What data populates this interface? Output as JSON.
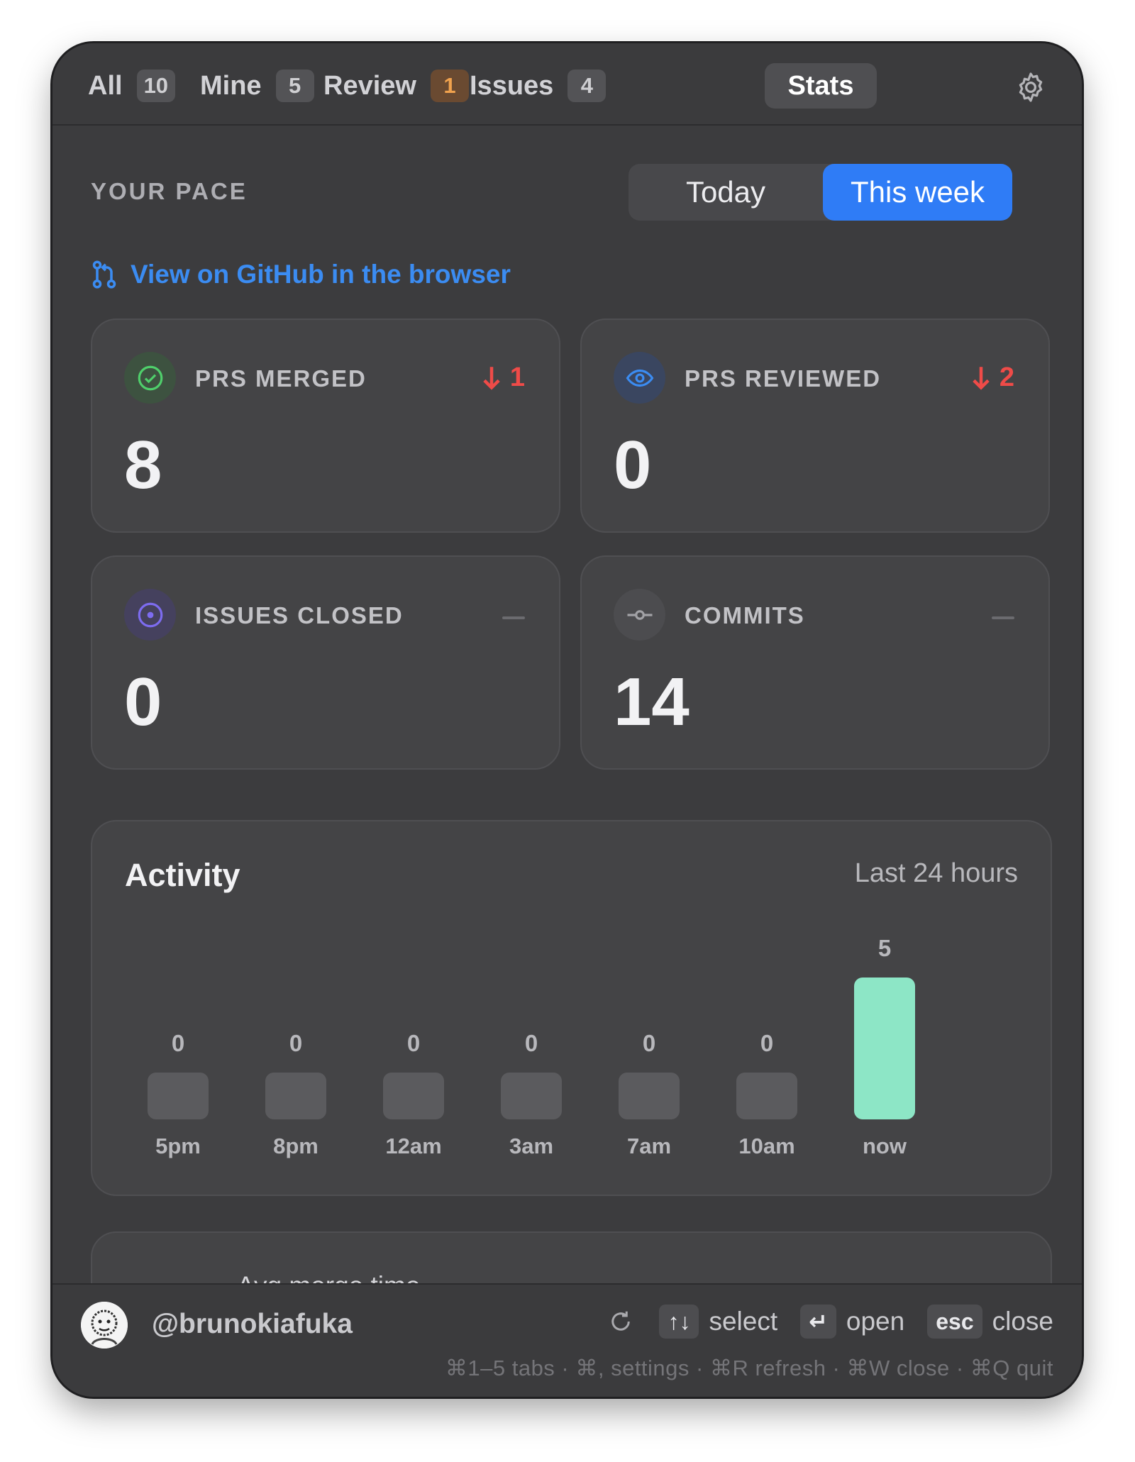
{
  "tabs": [
    {
      "label": "All",
      "badge": "10"
    },
    {
      "label": "Mine",
      "badge": "5"
    },
    {
      "label": "Review",
      "badge": "1"
    },
    {
      "label": "Issues",
      "badge": "4"
    },
    {
      "label": "Stats",
      "badge": ""
    }
  ],
  "active_tab": "Stats",
  "pace": {
    "label": "YOUR PACE",
    "today": "Today",
    "week": "This week",
    "selected": "This week"
  },
  "github_link": "View on GitHub in the browser",
  "stats": [
    {
      "title": "PRS MERGED",
      "value": "8",
      "delta": "1",
      "delta_direction": "down",
      "icon": "check-circle-icon"
    },
    {
      "title": "PRS REVIEWED",
      "value": "0",
      "delta": "2",
      "delta_direction": "down",
      "icon": "eye-icon"
    },
    {
      "title": "ISSUES CLOSED",
      "value": "0",
      "delta": "",
      "delta_direction": "none",
      "icon": "issue-icon"
    },
    {
      "title": "COMMITS",
      "value": "14",
      "delta": "",
      "delta_direction": "none",
      "icon": "commit-icon"
    }
  ],
  "activity": {
    "title": "Activity",
    "range": "Last 24 hours"
  },
  "chart_data": {
    "type": "bar",
    "categories": [
      "5pm",
      "8pm",
      "12am",
      "3am",
      "7am",
      "10am",
      "now"
    ],
    "values": [
      0,
      0,
      0,
      0,
      0,
      0,
      5
    ],
    "ylim": [
      0,
      5
    ],
    "grid": false
  },
  "avg_merge_label": "Avg merge time",
  "footer": {
    "username": "@brunokiafuka",
    "select_keys": "↑↓",
    "select_label": "select",
    "open_key": "↵",
    "open_label": "open",
    "close_key": "esc",
    "close_label": "close",
    "shortcuts": "⌘1–5 tabs · ⌘, settings · ⌘R refresh · ⌘W close · ⌘Q quit"
  },
  "colors": {
    "accent": "#2f7cf6",
    "link": "#3b8cf2",
    "delta_down": "#ef4b48",
    "bar_active": "#8de6c6",
    "bar_idle": "#5b5b5e",
    "badge_warn": "#f0a24e"
  }
}
